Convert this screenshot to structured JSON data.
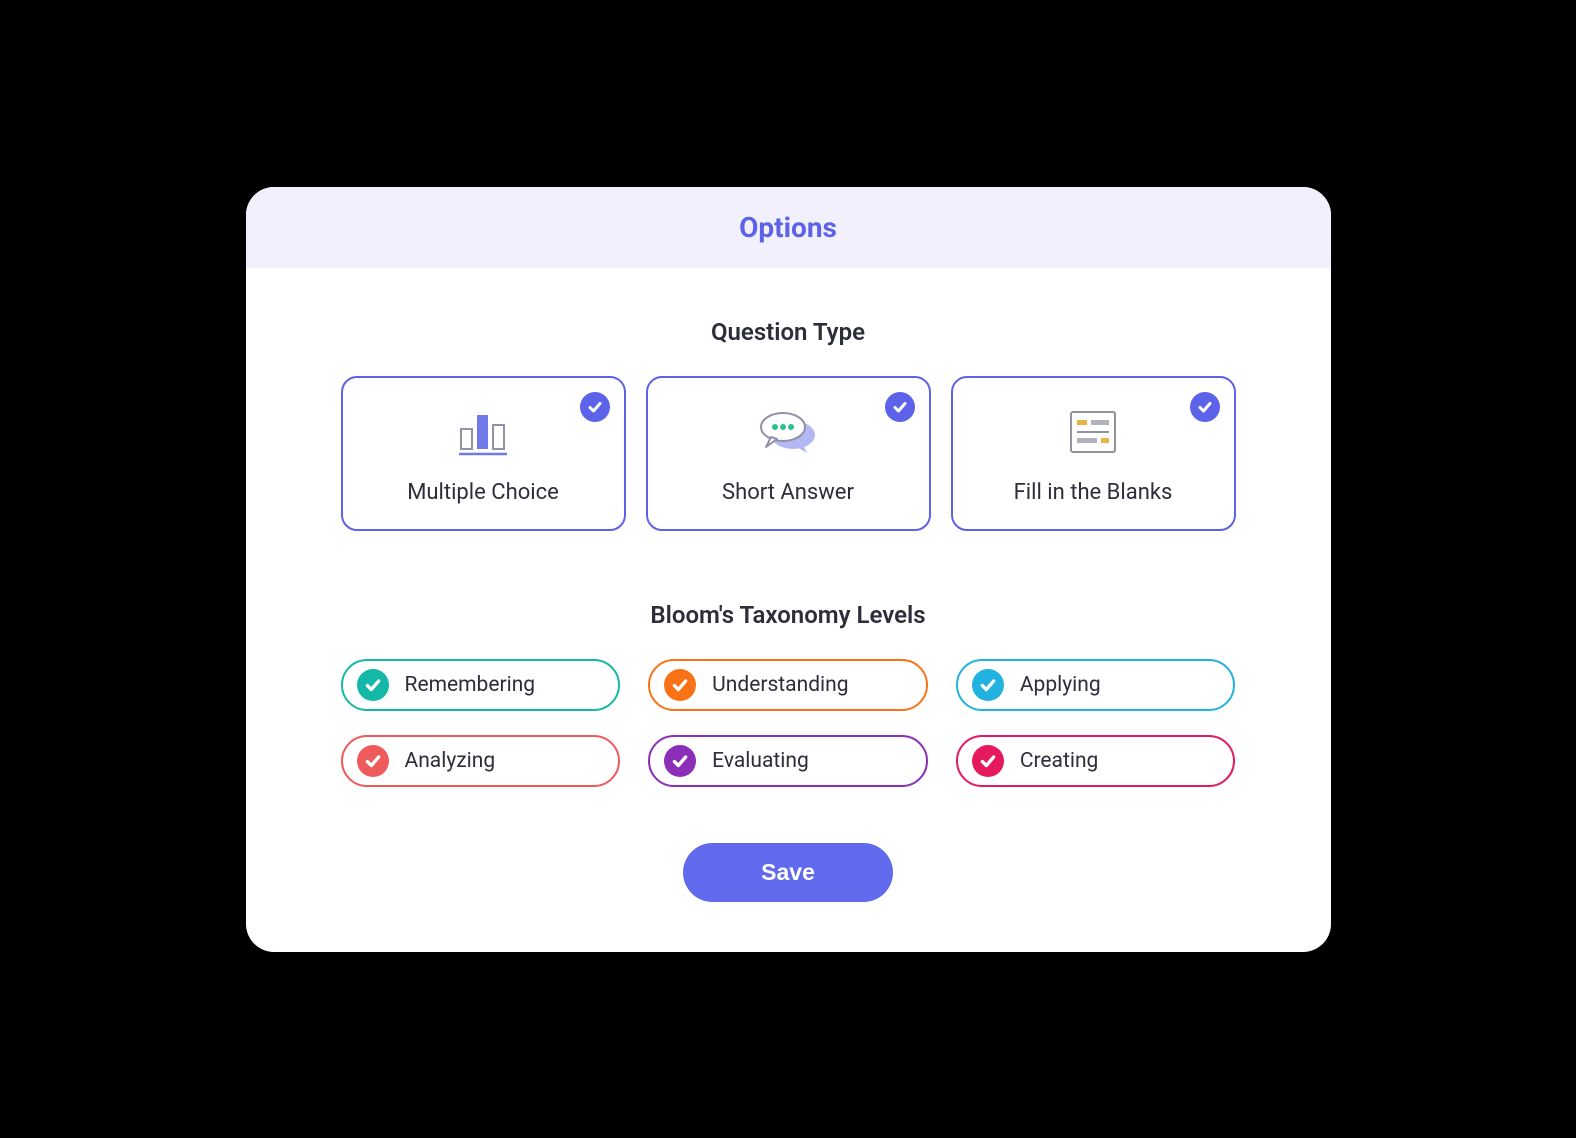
{
  "modal": {
    "title": "Options",
    "save_label": "Save"
  },
  "question_types": {
    "title": "Question Type",
    "items": [
      {
        "label": "Multiple Choice",
        "icon": "bar-chart-icon",
        "selected": true
      },
      {
        "label": "Short Answer",
        "icon": "chat-bubble-icon",
        "selected": true
      },
      {
        "label": "Fill in the Blanks",
        "icon": "form-icon",
        "selected": true
      }
    ]
  },
  "taxonomy": {
    "title": "Bloom's Taxonomy Levels",
    "items": [
      {
        "label": "Remembering",
        "color": "#14B8A6",
        "selected": true
      },
      {
        "label": "Understanding",
        "color": "#F97316",
        "selected": true
      },
      {
        "label": "Applying",
        "color": "#22B2E0",
        "selected": true
      },
      {
        "label": "Analyzing",
        "color": "#EF5B5B",
        "selected": true
      },
      {
        "label": "Evaluating",
        "color": "#8B2FB8",
        "selected": true
      },
      {
        "label": "Creating",
        "color": "#E6195F",
        "selected": true
      }
    ]
  },
  "colors": {
    "accent": "#5C63E8"
  }
}
